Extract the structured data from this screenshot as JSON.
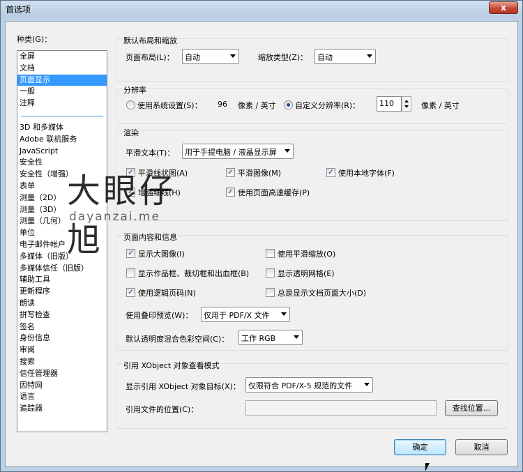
{
  "window": {
    "title": "首选项",
    "close_glyph": "x"
  },
  "categories": {
    "label": "种类(G)：",
    "top_items": [
      "全屏",
      "文档",
      "页面显示",
      "一般",
      "注释"
    ],
    "selected": "页面显示",
    "items": [
      "3D 和多媒体",
      "Adobe 联机服务",
      "JavaScript",
      "安全性",
      "安全性（增强）",
      "表单",
      "测量（2D）",
      "测量（3D）",
      "测量（几何）",
      "单位",
      "电子邮件帐户",
      "多媒体（旧版）",
      "多媒体信任（旧版）",
      "辅助工具",
      "更新程序",
      "朗读",
      "拼写检查",
      "签名",
      "身份信息",
      "审阅",
      "搜索",
      "信任管理器",
      "因特网",
      "语言",
      "追踪器"
    ]
  },
  "layout_zoom": {
    "title": "默认布局和缩放",
    "page_layout_label": "页面布局(L)：",
    "page_layout_value": "自动",
    "zoom_label": "缩放类型(Z)：",
    "zoom_value": "自动"
  },
  "resolution": {
    "title": "分辨率",
    "system_label": "使用系统设置(S)：",
    "system_value": "96",
    "system_unit": "像素 / 英寸",
    "custom_label": "自定义分辨率(R)：",
    "custom_value": "110",
    "custom_unit": "像素 / 英寸",
    "selected": "custom"
  },
  "rendering": {
    "title": "渲染",
    "smooth_text_label": "平滑文本(T)：",
    "smooth_text_value": "用于手提电脑 / 液晶显示屏",
    "options": [
      {
        "label": "平滑线状图(A)",
        "checked": true
      },
      {
        "label": "平滑图像(M)",
        "checked": true
      },
      {
        "label": "使用本地字体(F)",
        "checked": true
      },
      {
        "label": "增强细线(H)",
        "checked": true
      },
      {
        "label": "使用页面高速缓存(P)",
        "checked": true
      }
    ]
  },
  "page_content": {
    "title": "页面内容和信息",
    "options": [
      {
        "label": "显示大图像(I)",
        "checked": true
      },
      {
        "label": "使用平滑缩放(O)",
        "checked": false
      },
      {
        "label": "显示作品框、裁切框和出血框(B)",
        "checked": false
      },
      {
        "label": "显示透明网格(E)",
        "checked": false
      },
      {
        "label": "使用逻辑页码(N)",
        "checked": true
      },
      {
        "label": "总是显示文档页面大小(D)",
        "checked": false
      }
    ],
    "overprint_label": "使用叠印预览(W)：",
    "overprint_value": "仅用于 PDF/X 文件",
    "blend_label": "默认透明度混合色彩空间(C)：",
    "blend_value": "工作 RGB"
  },
  "xobject": {
    "title": "引用 XObject 对象查看模式",
    "target_label": "显示引用 XObject 对象目标(X)：",
    "target_value": "仅限符合 PDF/X-5 规范的文件",
    "location_label": "引用文件的位置(C)：",
    "location_value": "",
    "browse_label": "查找位置..."
  },
  "buttons": {
    "ok": "确定",
    "cancel": "取消"
  },
  "watermark": {
    "text": "大眼仔旭",
    "url": "dayanzai.me"
  },
  "glyphs": {
    "check": "✓"
  }
}
